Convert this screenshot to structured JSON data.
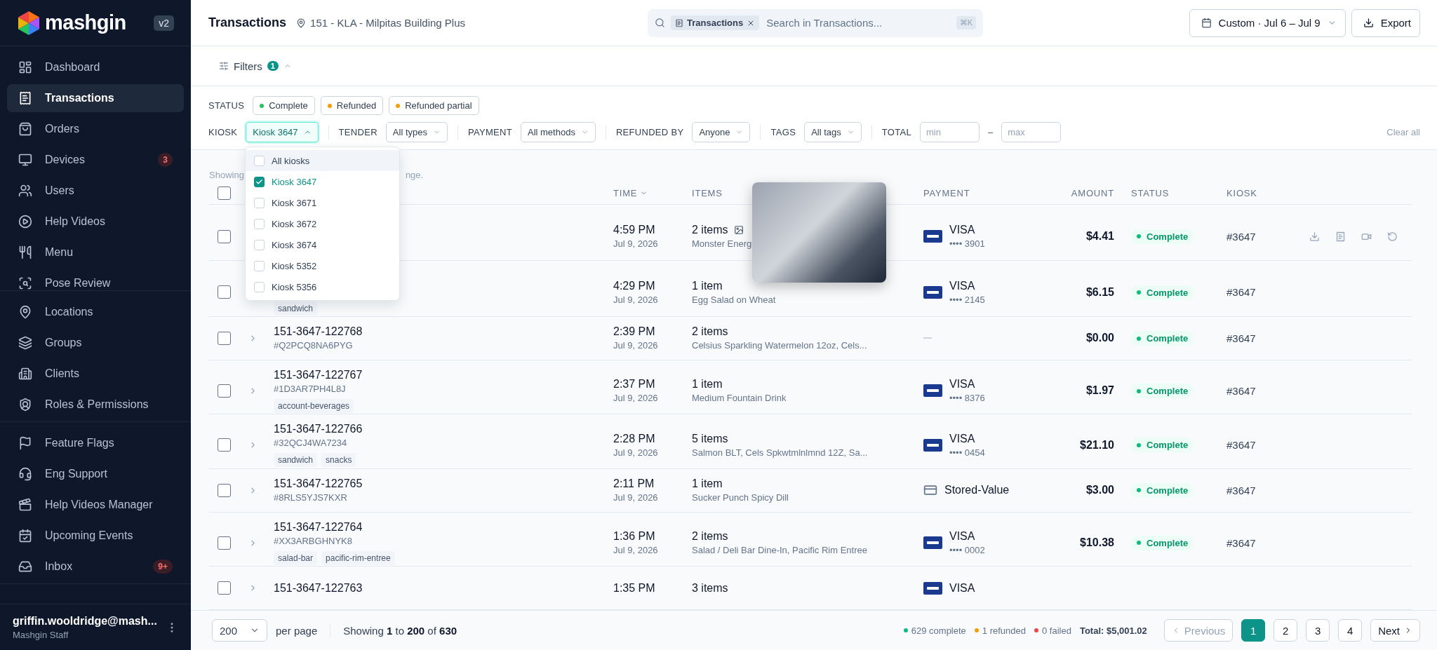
{
  "sidebar": {
    "logo": "mashgin",
    "version": "v2",
    "sections": [
      [
        {
          "label": "Dashboard",
          "selected": false
        },
        {
          "label": "Transactions",
          "selected": true
        },
        {
          "label": "Orders",
          "selected": false
        },
        {
          "label": "Devices",
          "selected": false,
          "badge": "3"
        },
        {
          "label": "Users",
          "selected": false
        },
        {
          "label": "Help Videos",
          "selected": false
        },
        {
          "label": "Menu",
          "selected": false
        },
        {
          "label": "Pose Review",
          "selected": false
        }
      ],
      [
        {
          "label": "Locations",
          "selected": false
        },
        {
          "label": "Groups",
          "selected": false
        },
        {
          "label": "Clients",
          "selected": false
        },
        {
          "label": "Roles & Permissions",
          "selected": false
        }
      ],
      [
        {
          "label": "Feature Flags",
          "selected": false
        },
        {
          "label": "Eng Support",
          "selected": false
        },
        {
          "label": "Help Videos Manager",
          "selected": false
        },
        {
          "label": "Upcoming Events",
          "selected": false
        },
        {
          "label": "Inbox",
          "selected": false,
          "badge": "9+"
        }
      ]
    ],
    "user": {
      "name": "griffin.wooldridge@mash...",
      "role": "Mashgin Staff"
    }
  },
  "header": {
    "title": "Transactions",
    "location": "151 - KLA - Milpitas Building Plus",
    "search": {
      "chip": "Transactions",
      "placeholder": "Search in Transactions...",
      "shortcut": "⌘K"
    },
    "date_range": "Custom · Jul 6 – Jul 9",
    "export": "Export"
  },
  "filters": {
    "label": "Filters",
    "count": "1",
    "expanded": true,
    "status": {
      "label": "STATUS",
      "options": [
        {
          "label": "Complete",
          "color": "#22c55e"
        },
        {
          "label": "Refunded",
          "color": "#f59e0b"
        },
        {
          "label": "Refunded partial",
          "color": "#f59e0b"
        }
      ]
    },
    "controls": [
      {
        "kind": "select",
        "label": "KIOSK",
        "value": "Kiosk 3647",
        "open": true
      },
      {
        "kind": "select",
        "label": "TENDER",
        "value": "All types",
        "open": false
      },
      {
        "kind": "select",
        "label": "PAYMENT",
        "value": "All methods",
        "open": false
      },
      {
        "kind": "select",
        "label": "REFUNDED BY",
        "value": "Anyone",
        "open": false
      },
      {
        "kind": "select",
        "label": "TAGS",
        "value": "All tags",
        "open": false
      },
      {
        "kind": "range",
        "label": "TOTAL",
        "min_placeholder": "min",
        "separator": "–",
        "max_placeholder": "max"
      }
    ],
    "clear": "Clear all"
  },
  "kiosk_menu": {
    "options": [
      {
        "label": "All kiosks",
        "checked": false,
        "hovered": true
      },
      {
        "label": "Kiosk 3647",
        "checked": true,
        "hovered": false
      },
      {
        "label": "Kiosk 3671",
        "checked": false,
        "hovered": false
      },
      {
        "label": "Kiosk 3672",
        "checked": false,
        "hovered": false
      },
      {
        "label": "Kiosk 3674",
        "checked": false,
        "hovered": false
      },
      {
        "label": "Kiosk 5352",
        "checked": false,
        "hovered": false
      },
      {
        "label": "Kiosk 5356",
        "checked": false,
        "hovered": false
      }
    ]
  },
  "hint": {
    "start": "Showing",
    "end": "nge."
  },
  "table": {
    "all_selected": false,
    "columns": [
      {
        "label": "TIME",
        "sorted": true
      },
      {
        "label": "ITEMS",
        "sorted": false
      },
      {
        "label": "PAYMENT",
        "sorted": false
      },
      {
        "label": "AMOUNT",
        "sorted": false
      },
      {
        "label": "STATUS",
        "sorted": false
      },
      {
        "label": "KIOSK",
        "sorted": false
      }
    ],
    "rows": [
      {
        "selected": false,
        "tags": [],
        "time": "4:59 PM",
        "date": "Jul 9, 2026",
        "items": "2 items",
        "summary": "Monster Energ",
        "photo": true,
        "payment": {
          "kind": "card",
          "brand": "VISA",
          "last4": "•••• 3901"
        },
        "amount": "$4.41",
        "status": "Complete",
        "kiosk": "#3647",
        "hovered": true
      },
      {
        "selected": false,
        "tags": [
          "sandwich"
        ],
        "time": "4:29 PM",
        "date": "Jul 9, 2026",
        "items": "1 item",
        "summary": "Egg Salad on Wheat",
        "photo": false,
        "payment": {
          "kind": "card",
          "brand": "VISA",
          "last4": "•••• 2145"
        },
        "amount": "$6.15",
        "status": "Complete",
        "kiosk": "#3647",
        "hovered": false
      },
      {
        "selected": false,
        "expanded": false,
        "id": "151-3647-122768",
        "code": "#Q2PCQ8NA6PYG",
        "tags": [],
        "time": "2:39 PM",
        "date": "Jul 9, 2026",
        "items": "2 items",
        "summary": "Celsius Sparkling Watermelon 12oz, Cels...",
        "photo": false,
        "payment": {
          "kind": "none"
        },
        "amount": "$0.00",
        "status": "Complete",
        "kiosk": "#3647",
        "hovered": false
      },
      {
        "selected": false,
        "expanded": false,
        "id": "151-3647-122767",
        "code": "#1D3AR7PH4L8J",
        "tags": [
          "account-beverages"
        ],
        "time": "2:37 PM",
        "date": "Jul 9, 2026",
        "items": "1 item",
        "summary": "Medium Fountain Drink",
        "photo": false,
        "payment": {
          "kind": "card",
          "brand": "VISA",
          "last4": "•••• 8376"
        },
        "amount": "$1.97",
        "status": "Complete",
        "kiosk": "#3647",
        "hovered": false
      },
      {
        "selected": false,
        "expanded": false,
        "id": "151-3647-122766",
        "code": "#32QCJ4WA7234",
        "tags": [
          "sandwich",
          "snacks"
        ],
        "time": "2:28 PM",
        "date": "Jul 9, 2026",
        "items": "5 items",
        "summary": "Salmon BLT, Cels Spkwtmlnlmnd 12Z, Sa...",
        "photo": false,
        "payment": {
          "kind": "card",
          "brand": "VISA",
          "last4": "•••• 0454"
        },
        "amount": "$21.10",
        "status": "Complete",
        "kiosk": "#3647",
        "hovered": false
      },
      {
        "selected": false,
        "expanded": false,
        "id": "151-3647-122765",
        "code": "#8RLS5YJS7KXR",
        "tags": [],
        "time": "2:11 PM",
        "date": "Jul 9, 2026",
        "items": "1 item",
        "summary": "Sucker Punch Spicy Dill",
        "photo": false,
        "payment": {
          "kind": "stored_value",
          "brand": "Stored-Value"
        },
        "amount": "$3.00",
        "status": "Complete",
        "kiosk": "#3647",
        "hovered": false
      },
      {
        "selected": false,
        "expanded": false,
        "id": "151-3647-122764",
        "code": "#XX3ARBGHNYK8",
        "tags": [
          "salad-bar",
          "pacific-rim-entree"
        ],
        "time": "1:36 PM",
        "date": "Jul 9, 2026",
        "items": "2 items",
        "summary": "Salad / Deli Bar Dine-In, Pacific Rim Entree",
        "photo": false,
        "payment": {
          "kind": "card",
          "brand": "VISA",
          "last4": "•••• 0002"
        },
        "amount": "$10.38",
        "status": "Complete",
        "kiosk": "#3647",
        "hovered": false
      },
      {
        "selected": false,
        "expanded": false,
        "id": "151-3647-122763",
        "tags": [],
        "time": "1:35 PM",
        "items": "3 items",
        "photo": false,
        "payment": {
          "kind": "card",
          "brand": "VISA"
        },
        "hovered": false
      }
    ]
  },
  "footer": {
    "page_size": "200",
    "per_page": "per page",
    "showing": "Showing **1** to **200** of **630**",
    "summary": [
      {
        "label": "629 complete",
        "color": "#10b981"
      },
      {
        "label": "1 refunded",
        "color": "#f59e0b"
      },
      {
        "label": "0 failed",
        "color": "#ef4444"
      }
    ],
    "total": "Total: $5,001.02",
    "previous": {
      "label": "Previous",
      "disabled": true
    },
    "pages": [
      {
        "label": "1",
        "selected": true
      },
      {
        "label": "2",
        "selected": false
      },
      {
        "label": "3",
        "selected": false
      },
      {
        "label": "4",
        "selected": false
      }
    ],
    "next": {
      "label": "Next",
      "disabled": false
    }
  }
}
